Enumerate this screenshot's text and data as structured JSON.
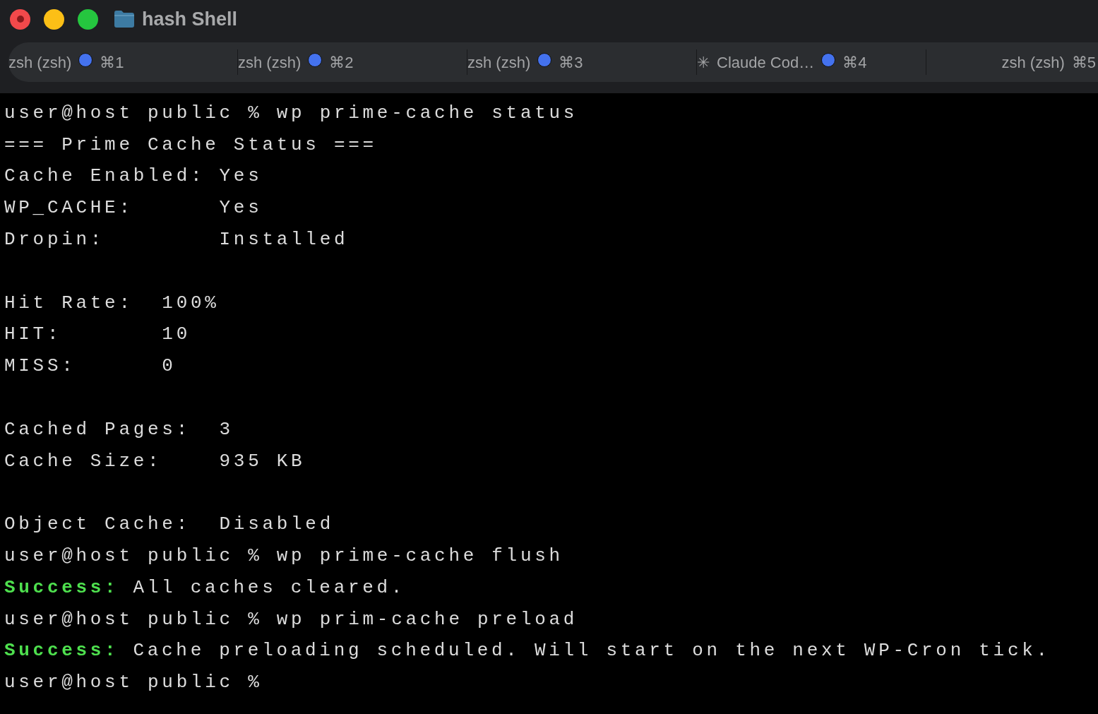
{
  "window": {
    "title": "hash Shell"
  },
  "tabs": [
    {
      "label": "zsh (zsh)",
      "dot": true,
      "shortcut": "⌘1"
    },
    {
      "label": "zsh (zsh)",
      "dot": true,
      "shortcut": "⌘2"
    },
    {
      "label": "zsh (zsh)",
      "dot": true,
      "shortcut": "⌘3"
    },
    {
      "prefix": "✳",
      "label": "Claude Cod…",
      "dot": true,
      "shortcut": "⌘4"
    },
    {
      "label": "zsh (zsh)",
      "dot": false,
      "shortcut": "⌘5"
    }
  ],
  "terminal": {
    "lines": [
      {
        "kind": "text",
        "text": "user@host public % wp prime-cache status"
      },
      {
        "kind": "text",
        "text": "=== Prime Cache Status ==="
      },
      {
        "kind": "text",
        "text": "Cache Enabled: Yes"
      },
      {
        "kind": "text",
        "text": "WP_CACHE:      Yes"
      },
      {
        "kind": "text",
        "text": "Dropin:        Installed"
      },
      {
        "kind": "blank"
      },
      {
        "kind": "text",
        "text": "Hit Rate:  100%"
      },
      {
        "kind": "text",
        "text": "HIT:       10"
      },
      {
        "kind": "text",
        "text": "MISS:      0"
      },
      {
        "kind": "blank"
      },
      {
        "kind": "text",
        "text": "Cached Pages:  3"
      },
      {
        "kind": "text",
        "text": "Cache Size:    935 KB"
      },
      {
        "kind": "blank"
      },
      {
        "kind": "text",
        "text": "Object Cache:  Disabled"
      },
      {
        "kind": "text",
        "text": "user@host public % wp prime-cache flush"
      },
      {
        "kind": "success",
        "label": "Success:",
        "text": "All caches cleared."
      },
      {
        "kind": "text",
        "text": "user@host public % wp prim-cache preload"
      },
      {
        "kind": "success",
        "label": "Success:",
        "text": "Cache preloading scheduled. Will start on the next WP-Cron tick."
      },
      {
        "kind": "text",
        "text": "user@host public %"
      }
    ]
  }
}
